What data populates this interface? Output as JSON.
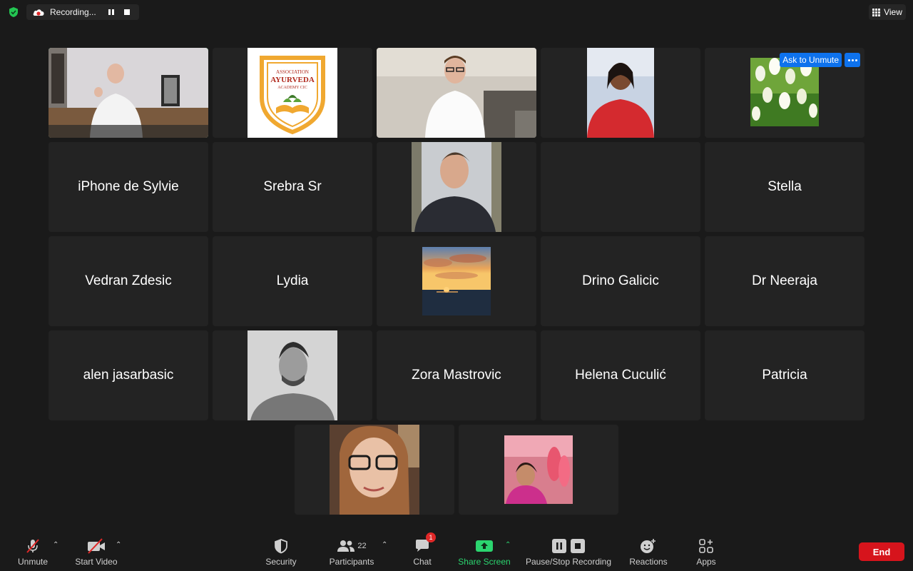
{
  "topbar": {
    "recording_label": "Recording...",
    "view_label": "View"
  },
  "tiles": [
    {
      "name": "",
      "ask_to_unmute": ""
    },
    {
      "logo_line1": "ASSOCIATION",
      "logo_line2": "AYURVEDA",
      "logo_line3": "ACADEMY CIC"
    },
    {
      "name": "iPhone de Sylvie"
    },
    {
      "name": "Srebra Sr"
    },
    {
      "name": "Stella"
    },
    {
      "name": "Vedran Zdesic"
    },
    {
      "name": "Lydia"
    },
    {
      "name": "Drino Galicic"
    },
    {
      "name": "Dr Neeraja"
    },
    {
      "name": "alen jasarbasic"
    },
    {
      "name": "Zora Mastrovic"
    },
    {
      "name": "Helena Cuculić"
    },
    {
      "name": "Patricia"
    }
  ],
  "ask_to_unmute": "Ask to Unmute",
  "toolbar": {
    "unmute": "Unmute",
    "start_video": "Start Video",
    "security": "Security",
    "participants": "Participants",
    "participants_count": "22",
    "chat": "Chat",
    "chat_badge": "1",
    "share_screen": "Share Screen",
    "pause_stop_recording": "Pause/Stop Recording",
    "reactions": "Reactions",
    "apps": "Apps",
    "end": "End"
  },
  "colors": {
    "active_speaker_border": "#22d05c",
    "share_green": "#2bd56f",
    "end_red": "#d6141c",
    "ask_blue": "#0e72ed"
  }
}
